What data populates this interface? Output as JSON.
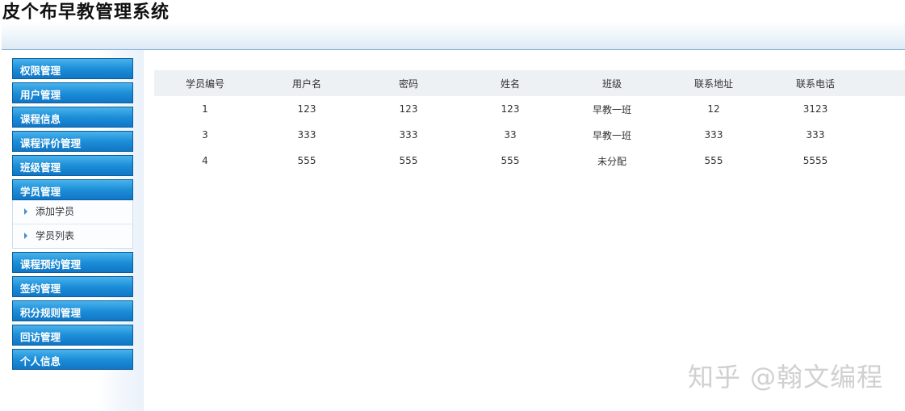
{
  "app": {
    "title": "皮个布早教管理系统"
  },
  "sidebar": {
    "items": [
      {
        "label": "权限管理"
      },
      {
        "label": "用户管理"
      },
      {
        "label": "课程信息"
      },
      {
        "label": "课程评价管理"
      },
      {
        "label": "班级管理"
      },
      {
        "label": "学员管理",
        "expanded": true,
        "children": [
          {
            "label": "添加学员"
          },
          {
            "label": "学员列表"
          }
        ]
      },
      {
        "label": "课程预约管理"
      },
      {
        "label": "签约管理"
      },
      {
        "label": "积分规则管理"
      },
      {
        "label": "回访管理"
      },
      {
        "label": "个人信息"
      }
    ]
  },
  "table": {
    "headers": [
      "学员编号",
      "用户名",
      "密码",
      "姓名",
      "班级",
      "联系地址",
      "联系电话"
    ],
    "rows": [
      [
        "1",
        "123",
        "123",
        "123",
        "早教一班",
        "12",
        "3123"
      ],
      [
        "3",
        "333",
        "333",
        "33",
        "早教一班",
        "333",
        "333"
      ],
      [
        "4",
        "555",
        "555",
        "555",
        "未分配",
        "555",
        "5555"
      ]
    ]
  },
  "watermark": {
    "text": "知乎 @翰文编程"
  },
  "colors": {
    "menu_accent": "#1d8ed8",
    "header_line": "#7fb1d8",
    "table_header_bg": "#eef1f4"
  }
}
